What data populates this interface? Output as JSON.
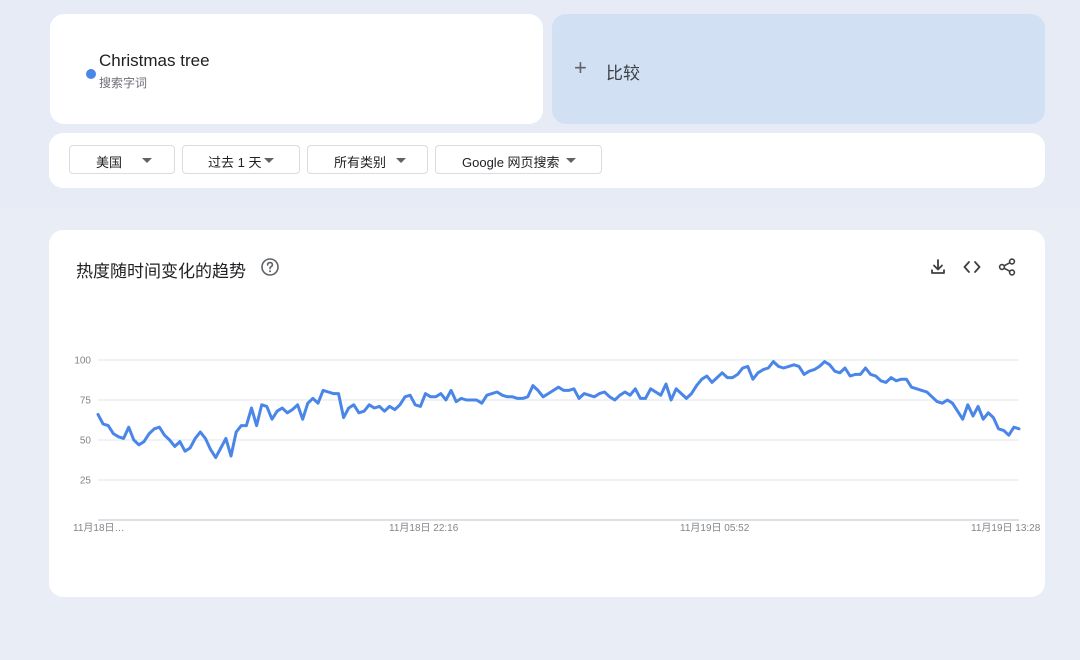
{
  "search_term": {
    "term": "Christmas tree",
    "type_label": "搜索字词",
    "color": "#4a86e8"
  },
  "compare": {
    "plus": "+",
    "label": "比较"
  },
  "filters": [
    {
      "label": "美国"
    },
    {
      "label": "过去 1 天"
    },
    {
      "label": "所有类别"
    },
    {
      "label": "Google 网页搜索"
    }
  ],
  "chart_panel": {
    "title": "热度随时间变化的趋势",
    "icons": [
      "help-icon",
      "download-icon",
      "embed-code-icon",
      "share-icon"
    ]
  },
  "chart_data": {
    "type": "line",
    "ylim": [
      0,
      100
    ],
    "yticks": [
      25,
      50,
      75,
      100
    ],
    "xtick_labels": [
      "11月18日…",
      "11月18日 22:16",
      "11月19日 05:52",
      "11月19日 13:28"
    ],
    "series": [
      {
        "color": "#4a86e8",
        "values": [
          66,
          60,
          59,
          54,
          52,
          51,
          58,
          50,
          47,
          49,
          54,
          57,
          58,
          53,
          50,
          46,
          49,
          43,
          45,
          51,
          55,
          51,
          44,
          39,
          45,
          51,
          40,
          55,
          59,
          59,
          70,
          59,
          72,
          71,
          63,
          68,
          70,
          67,
          69,
          72,
          63,
          73,
          76,
          73,
          81,
          80,
          79,
          79,
          64,
          70,
          72,
          67,
          68,
          72,
          70,
          71,
          68,
          71,
          69,
          72,
          77,
          78,
          72,
          71,
          79,
          77,
          77,
          79,
          75,
          81,
          74,
          76,
          75,
          75,
          75,
          73,
          78,
          79,
          80,
          78,
          77,
          77,
          76,
          76,
          77,
          84,
          81,
          77,
          79,
          81,
          83,
          81,
          81,
          82,
          76,
          79,
          78,
          77,
          79,
          80,
          77,
          75,
          78,
          80,
          78,
          82,
          76,
          76,
          82,
          80,
          78,
          85,
          75,
          82,
          79,
          76,
          79,
          84,
          88,
          90,
          86,
          89,
          92,
          89,
          89,
          91,
          95,
          96,
          88,
          92,
          94,
          95,
          99,
          96,
          95,
          96,
          97,
          96,
          91,
          93,
          94,
          96,
          99,
          97,
          93,
          92,
          95,
          90,
          91,
          91,
          95,
          91,
          90,
          87,
          86,
          89,
          87,
          88,
          88,
          83,
          82,
          81,
          80,
          77,
          74,
          73,
          75,
          73,
          68,
          63,
          72,
          65,
          71,
          63,
          67,
          64,
          57,
          56,
          53,
          58,
          57
        ]
      }
    ]
  }
}
